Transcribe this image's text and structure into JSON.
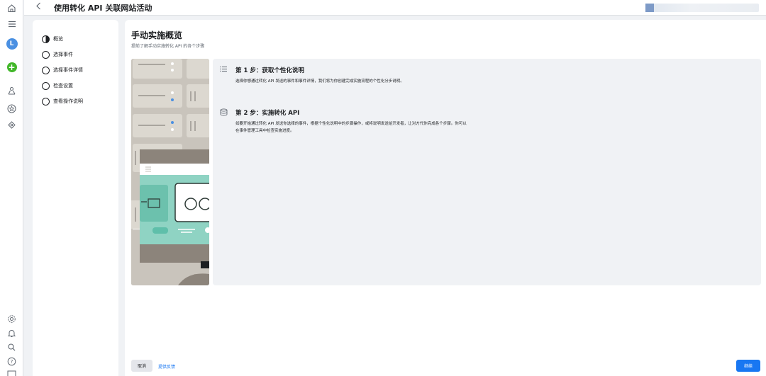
{
  "header": {
    "title": "使用转化 API 关联网站活动"
  },
  "rail": {
    "avatar_letter": "L"
  },
  "steps": [
    {
      "label": "概览",
      "state": "current"
    },
    {
      "label": "选择事件",
      "state": "todo"
    },
    {
      "label": "选择事件详情",
      "state": "todo"
    },
    {
      "label": "检查设置",
      "state": "todo"
    },
    {
      "label": "查看操作说明",
      "state": "todo"
    }
  ],
  "main": {
    "heading": "手动实施概览",
    "subheading": "提前了解手动实施转化 API 的各个步骤",
    "sections": [
      {
        "icon": "list-icon",
        "title": "第 1 步：获取个性化说明",
        "body": "选择你想通过转化 API 发送的事件和事件详情，我们将为你创建完成实施流程的个性化分步说明。"
      },
      {
        "icon": "stack-icon",
        "title": "第 2 步：实施转化 API",
        "body": "如要开始通过转化 API 发送你选择的事件，根据个性化说明中的步骤操作，或将说明发送给开发者，让对方代你完成各个步骤。你可以在事件管理工具中检查实施进度。"
      }
    ]
  },
  "footer": {
    "cancel_label": "取消",
    "feedback_label": "提供反馈",
    "continue_label": "继续"
  },
  "colors": {
    "accent": "#1877f2",
    "add_green": "#42b72a",
    "avatar_blue": "#4a90e2"
  }
}
